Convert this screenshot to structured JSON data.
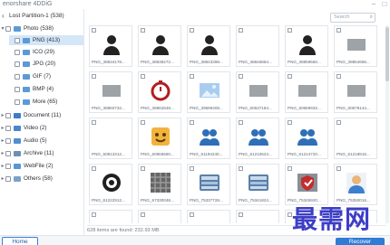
{
  "app": {
    "brand": "enorshare 4DDiG"
  },
  "tree": {
    "crumb": "Lost Partition-1 (538)",
    "items": [
      {
        "label": "Photo",
        "count": "(538)"
      },
      {
        "label": "PNG",
        "count": "(413)"
      },
      {
        "label": "ICO",
        "count": "(29)"
      },
      {
        "label": "JPG",
        "count": "(20)"
      },
      {
        "label": "GIF",
        "count": "(7)"
      },
      {
        "label": "BMP",
        "count": "(4)"
      },
      {
        "label": "More",
        "count": "(65)"
      },
      {
        "label": "Document",
        "count": "(11)"
      },
      {
        "label": "Video",
        "count": "(2)"
      },
      {
        "label": "Audio",
        "count": "(5)"
      },
      {
        "label": "Archive",
        "count": "(11)"
      },
      {
        "label": "WebFile",
        "count": "(2)"
      },
      {
        "label": "Others",
        "count": "(58)"
      }
    ]
  },
  "search": {
    "placeholder": "Search"
  },
  "grid": {
    "items": [
      {
        "name": "PNG_38834178...",
        "icon": "person-icon"
      },
      {
        "name": "PNG_38838272...",
        "icon": "person-icon"
      },
      {
        "name": "PNG_38843398...",
        "icon": "person-icon"
      },
      {
        "name": "PNG_38846864...",
        "icon": "blank-icon"
      },
      {
        "name": "PNG_38859560...",
        "icon": "person-icon"
      },
      {
        "name": "PNG_38854656...",
        "icon": "gray-box-icon"
      },
      {
        "name": "PNG_38850732...",
        "icon": "gray-box-icon"
      },
      {
        "name": "PNG_38862848...",
        "icon": "timer-icon"
      },
      {
        "name": "PNG_39599408...",
        "icon": "image-icon"
      },
      {
        "name": "PNG_60637184...",
        "icon": "gray-box-icon"
      },
      {
        "name": "PNG_60669932...",
        "icon": "gray-box-icon"
      },
      {
        "name": "PNG_60678144...",
        "icon": "gray-box-icon"
      },
      {
        "name": "PNG_60813312...",
        "icon": "blank-icon"
      },
      {
        "name": "PNG_60966560...",
        "icon": "emoji-icon"
      },
      {
        "name": "PNG_61194240...",
        "icon": "users-icon"
      },
      {
        "name": "PNG_61210624...",
        "icon": "users-icon"
      },
      {
        "name": "PNG_61214720...",
        "icon": "users-icon"
      },
      {
        "name": "PNG_61218816...",
        "icon": "blank-icon"
      },
      {
        "name": "PNG_61222912...",
        "icon": "disc-icon"
      },
      {
        "name": "PNG_67330048...",
        "icon": "pattern-icon"
      },
      {
        "name": "PNG_75337728...",
        "icon": "scan-icon"
      },
      {
        "name": "PNG_75341824...",
        "icon": "scan-icon"
      },
      {
        "name": "PNG_75345920...",
        "icon": "shield-icon"
      },
      {
        "name": "PNG_75350016...",
        "icon": "avatar-icon"
      },
      {
        "name": "",
        "icon": "blank-icon"
      },
      {
        "name": "",
        "icon": "colorful-icon"
      },
      {
        "name": "",
        "icon": "blank-icon"
      },
      {
        "name": "",
        "icon": "blank-icon"
      },
      {
        "name": "",
        "icon": "blank-icon"
      },
      {
        "name": "",
        "icon": "blank-icon"
      }
    ]
  },
  "status": {
    "text": "628 items are found: 232.93 MB"
  },
  "buttons": {
    "home": "Home",
    "recover": "Recover"
  },
  "watermark": {
    "text": "最需网"
  },
  "colors": {
    "accent": "#2f7bd6",
    "selected_row": "#d4e6f8",
    "watermark": "#2d2ec2"
  }
}
